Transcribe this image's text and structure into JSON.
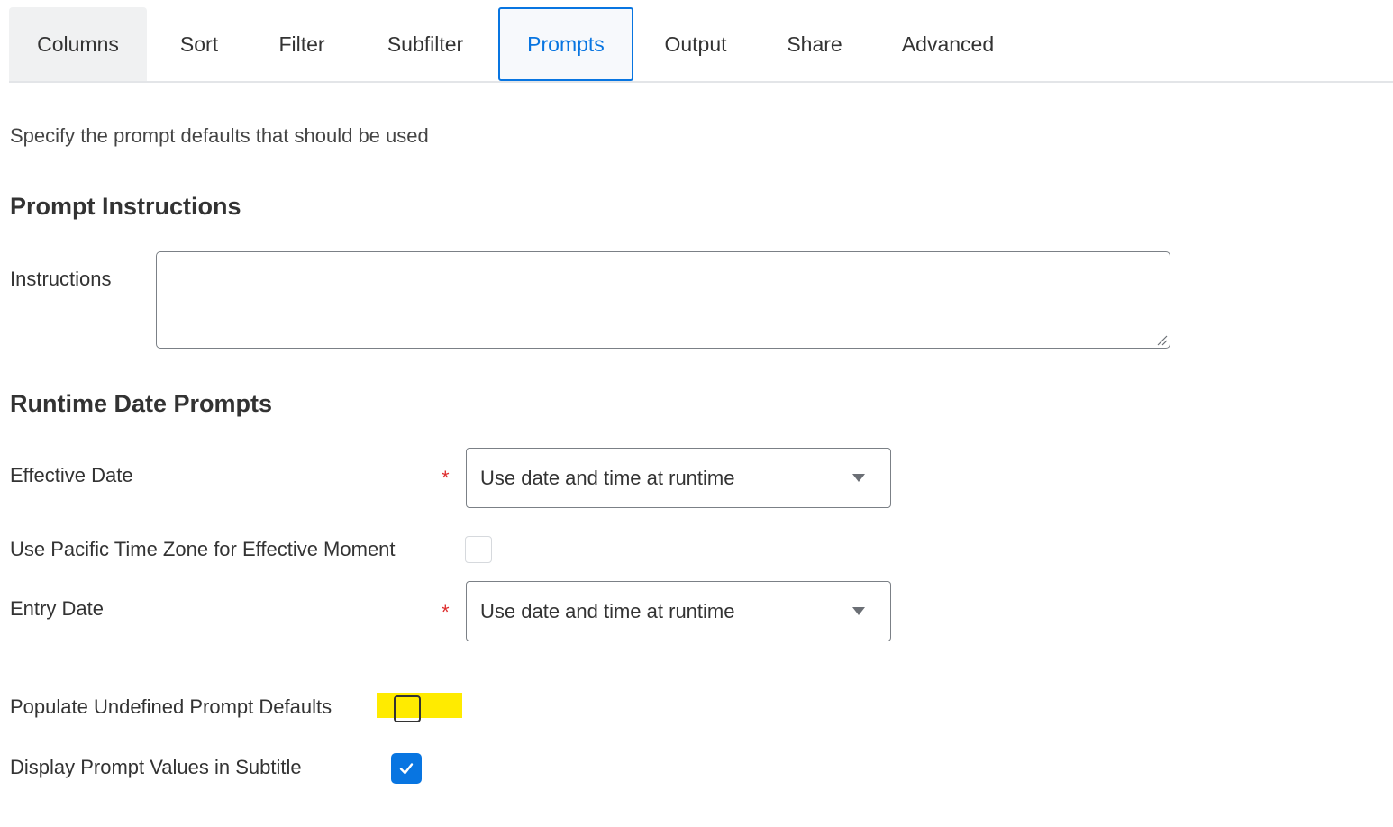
{
  "tabs": [
    {
      "label": "Columns",
      "active": false
    },
    {
      "label": "Sort",
      "active": false
    },
    {
      "label": "Filter",
      "active": false
    },
    {
      "label": "Subfilter",
      "active": false
    },
    {
      "label": "Prompts",
      "active": true
    },
    {
      "label": "Output",
      "active": false
    },
    {
      "label": "Share",
      "active": false
    },
    {
      "label": "Advanced",
      "active": false
    }
  ],
  "description": "Specify the prompt defaults that should be used",
  "prompt_instructions": {
    "title": "Prompt Instructions",
    "instructions_label": "Instructions",
    "instructions_value": ""
  },
  "runtime_date_prompts": {
    "title": "Runtime Date Prompts",
    "effective_date": {
      "label": "Effective Date",
      "required_mark": "*",
      "value": "Use date and time at runtime"
    },
    "pacific_time_zone": {
      "label": "Use Pacific Time Zone for Effective Moment",
      "checked": false
    },
    "entry_date": {
      "label": "Entry Date",
      "required_mark": "*",
      "value": "Use date and time at runtime"
    }
  },
  "populate_undefined": {
    "label": "Populate Undefined Prompt Defaults",
    "checked": false,
    "highlight_color": "#ffeb00"
  },
  "display_prompt_values": {
    "label": "Display Prompt Values in Subtitle",
    "checked": true
  },
  "colors": {
    "accent": "#0875e1",
    "required": "#de2c2c"
  }
}
